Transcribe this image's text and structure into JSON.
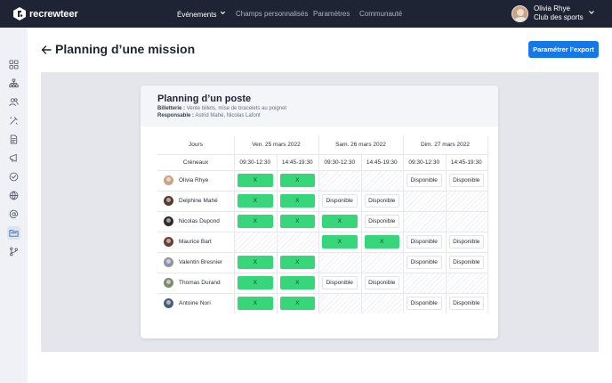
{
  "app": {
    "name": "recrewteer"
  },
  "nav": {
    "items": [
      {
        "label": "Événements",
        "active": true,
        "dropdown": true
      },
      {
        "label": "Champs personnalisés",
        "active": false
      },
      {
        "label": "Paramètres",
        "active": false
      },
      {
        "label": "Communauté",
        "active": false
      }
    ]
  },
  "user": {
    "name": "Olivia Rhye",
    "club": "Club des sports"
  },
  "sidebar": {
    "icons": [
      "dashboard-icon",
      "org-chart-icon",
      "users-icon",
      "magic-tools-icon",
      "document-icon",
      "megaphone-icon",
      "check-circle-icon",
      "globe-icon",
      "at-sign-icon",
      "folder-icon",
      "git-branch-icon"
    ],
    "active_index": 9
  },
  "page": {
    "title": "Planning d’une mission",
    "export_label": "Paramétrer l’export"
  },
  "card": {
    "title": "Planning d’un poste",
    "billetterie_label": "Billetterie :",
    "billetterie_value": "Vente billets, mise de bracelets au poignet",
    "responsable_label": "Responsable :",
    "responsable_value": "Astrid Mahé, Nicolas Lafont"
  },
  "grid": {
    "jours_label": "Jours",
    "creneaux_label": "Créneaux",
    "days": [
      "Ven. 25 mars 2022",
      "Sam. 26 mars 2022",
      "Dim. 27 mars 2022"
    ],
    "slots": [
      "09:30-12:30",
      "14:45-19:30",
      "09:30-12:30",
      "14:45-19:30",
      "09:30-12:30",
      "14:45-19:30"
    ],
    "x_label": "X",
    "dispo_label": "Disponible",
    "colors": {
      "assigned": "#37d67a",
      "primary": "#1677e6",
      "topbar": "#1e2433"
    },
    "rows": [
      {
        "name": "Olivia Rhye",
        "avatar_color": "#c9a385",
        "cells": [
          "x",
          "x",
          "none",
          "none",
          "dispo",
          "dispo"
        ]
      },
      {
        "name": "Delphine Mahé",
        "avatar_color": "#5a3a2e",
        "cells": [
          "x",
          "x",
          "dispo",
          "dispo",
          "none",
          "none"
        ]
      },
      {
        "name": "Nicolas Dupond",
        "avatar_color": "#2f2b2a",
        "cells": [
          "x",
          "x",
          "x",
          "dispo",
          "none",
          "none"
        ]
      },
      {
        "name": "Maurice Bart",
        "avatar_color": "#6b3f35",
        "cells": [
          "none",
          "none",
          "x",
          "x",
          "dispo",
          "dispo"
        ]
      },
      {
        "name": "Valentin Bresnier",
        "avatar_color": "#8b94a8",
        "cells": [
          "x",
          "x",
          "none",
          "none",
          "dispo",
          "dispo"
        ]
      },
      {
        "name": "Thomas Durand",
        "avatar_color": "#7c8a6e",
        "cells": [
          "x",
          "x",
          "dispo",
          "dispo",
          "none",
          "none"
        ]
      },
      {
        "name": "Antoine Nori",
        "avatar_color": "#4b5d7a",
        "cells": [
          "x",
          "x",
          "none",
          "none",
          "dispo",
          "dispo"
        ]
      }
    ]
  }
}
